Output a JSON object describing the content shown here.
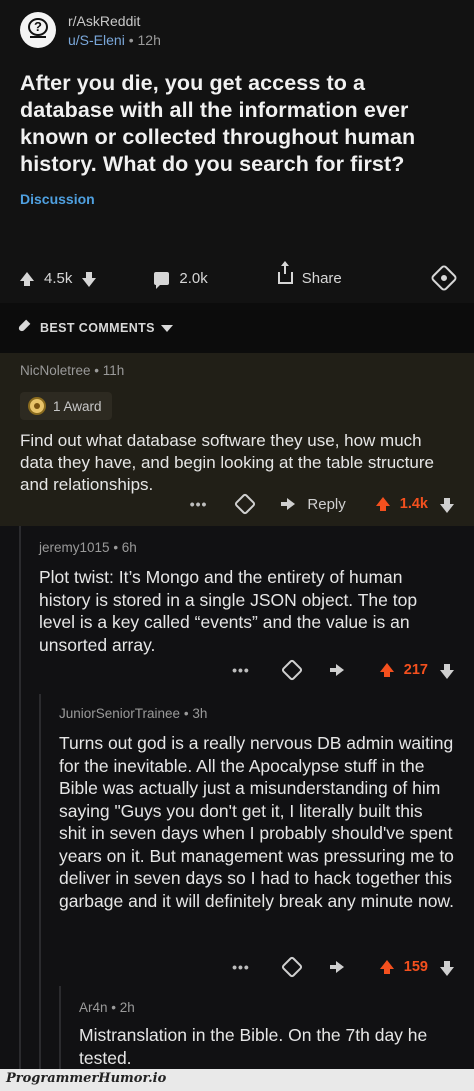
{
  "post": {
    "subreddit": "r/AskReddit",
    "author": "u/S-Eleni",
    "time": "12h",
    "title": "After you die, you get access to a database with all the information ever known or collected throughout human history. What do you search for first?",
    "flair": "Discussion",
    "upvotes": "4.5k",
    "comments": "2.0k",
    "share_label": "Share"
  },
  "sort": {
    "label": "BEST COMMENTS"
  },
  "comments": [
    {
      "author": "NicNoletree",
      "time": "11h",
      "award": "1 Award",
      "body": "Find out what database software they use, how much data they have, and begin looking at the table structure and relationships.",
      "reply_label": "Reply",
      "score": "1.4k"
    },
    {
      "author": "jeremy1015",
      "time": "6h",
      "body": "Plot twist: It’s Mongo and the entirety of human history is stored in a single JSON object. The top level is a key called “events” and the value is an unsorted array.",
      "score": "217"
    },
    {
      "author": "JuniorSeniorTrainee",
      "time": "3h",
      "body": "Turns out god is a really nervous DB admin waiting for the inevitable. All the Apocalypse stuff in the Bible was actually just a misunderstanding of him saying \"Guys you don't get it, I literally built this shit in seven days when I probably should've spent years on it. But management was pressuring me to deliver in seven days so I had to hack together this garbage and it will definitely break any minute now.",
      "score": "159"
    },
    {
      "author": "Ar4n",
      "time": "2h",
      "body": "Mistranslation in the Bible. On the 7th day he tested."
    }
  ],
  "watermark": "ProgrammerHumor.io",
  "colors": {
    "upvote": "#f4501e",
    "link": "#4fa0e0",
    "award_bg": "#211f17"
  }
}
